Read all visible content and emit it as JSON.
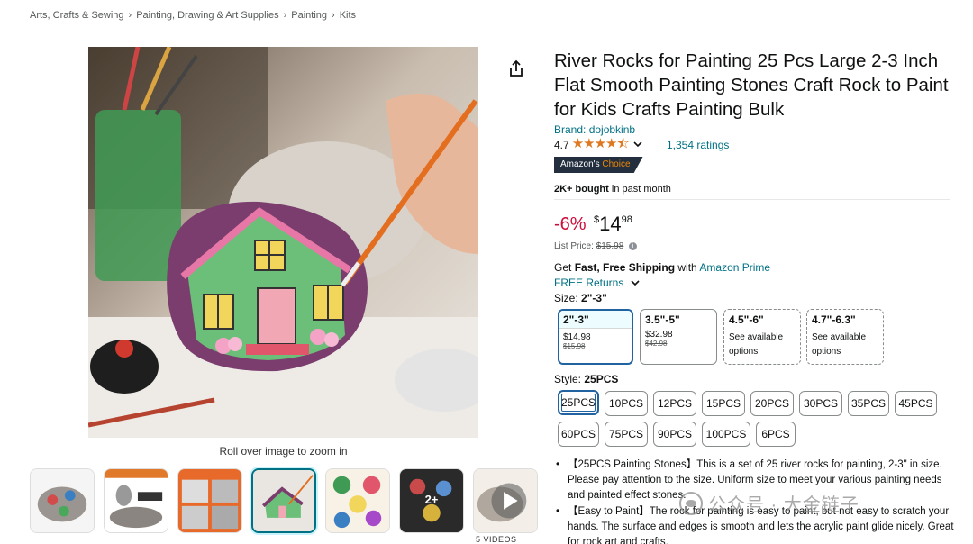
{
  "breadcrumb": [
    "Arts, Crafts & Sewing",
    "Painting, Drawing & Art Supplies",
    "Painting",
    "Kits"
  ],
  "gallery": {
    "zoom_hint": "Roll over image to zoom in",
    "more_badge": "2+",
    "videos_label": "5 VIDEOS"
  },
  "product": {
    "title": "River Rocks for Painting 25 Pcs Large 2-3 Inch Flat Smooth Painting Stones Craft Rock to Paint for Kids Crafts Painting Bulk",
    "brand": "Brand: dojobkinb",
    "rating": "4.7",
    "stars": "★★★★⯪",
    "ratings_count": "1,354 ratings",
    "badge_prefix": "Amazon's",
    "badge_word": "Choice",
    "bought_bold": "2K+ bought",
    "bought_rest": " in past month"
  },
  "pricing": {
    "discount": "-6%",
    "currency": "$",
    "whole": "14",
    "fraction": "98",
    "list_label": "List Price:",
    "list_value": "$15.98"
  },
  "shipping": {
    "prefix": "Get ",
    "bold": "Fast, Free Shipping",
    "middle": " with ",
    "prime": "Amazon Prime",
    "returns": "FREE Returns"
  },
  "size": {
    "label": "Size:",
    "selected": "2\"-3\"",
    "options": [
      {
        "name": "2\"-3\"",
        "price": "$14.98",
        "list": "$15.98"
      },
      {
        "name": "3.5\"-5\"",
        "price": "$32.98",
        "list": "$42.98"
      },
      {
        "name": "4.5\"-6\"",
        "note": "See available options"
      },
      {
        "name": "4.7\"-6.3\"",
        "note": "See available options"
      }
    ]
  },
  "style": {
    "label": "Style:",
    "selected": "25PCS",
    "options": [
      "25PCS",
      "10PCS",
      "12PCS",
      "15PCS",
      "20PCS",
      "30PCS",
      "35PCS",
      "45PCS",
      "60PCS",
      "75PCS",
      "90PCS",
      "100PCS",
      "6PCS"
    ]
  },
  "bullets": [
    "【25PCS Painting Stones】This is a set of 25 river rocks for painting, 2-3\" in size. Please pay attention to the size. Uniform size to meet your various painting needs and painted effect stones.",
    "【Easy to Paint】The rock for painting is easy to paint, but not easy to scratch your hands. The surface and edges is smooth and lets the acrylic paint glide nicely. Great for rock art and crafts."
  ],
  "watermark": "公众号 · 大金链子",
  "colors": {
    "link": "#007185",
    "discount": "#cc0c39",
    "star": "#de7921",
    "selected_border": "#2162a1",
    "badge_bg": "#232f3e",
    "badge_accent": "#f08804"
  }
}
